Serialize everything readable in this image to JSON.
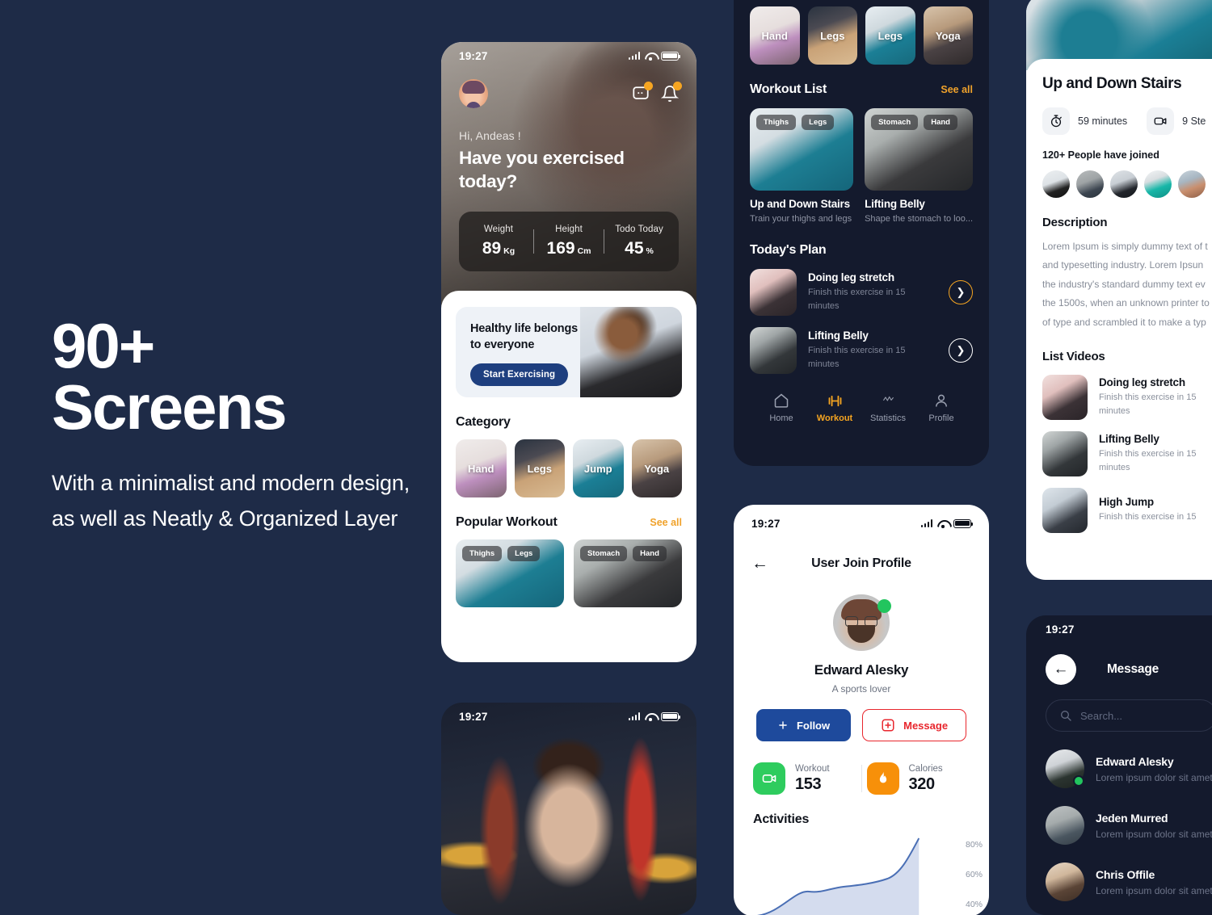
{
  "hero": {
    "title_line1": "90+",
    "title_line2": "Screens",
    "subtitle": "With a minimalist and modern design, as well as Neatly & Organized Layer"
  },
  "colors": {
    "background": "#1e2b47",
    "dark_screen": "#141a2d",
    "accent_orange": "#f6a521",
    "brand_blue": "#1e4a9c",
    "promo_blue": "#1e3f7f",
    "danger_red": "#e8262d",
    "green": "#2ecc5e"
  },
  "status_bar": {
    "time": "19:27"
  },
  "home_screen": {
    "greeting": "Hi, Andeas !",
    "question": "Have you exercised today?",
    "stats": [
      {
        "label": "Weight",
        "value": "89",
        "unit": "Kg"
      },
      {
        "label": "Height",
        "value": "169",
        "unit": "Cm"
      },
      {
        "label": "Todo Today",
        "value": "45",
        "unit": "%"
      }
    ],
    "promo": {
      "headline": "Healthy life belongs to everyone",
      "button": "Start Exercising"
    },
    "category_title": "Category",
    "categories": [
      {
        "label": "Hand"
      },
      {
        "label": "Legs"
      },
      {
        "label": "Jump"
      },
      {
        "label": "Yoga"
      }
    ],
    "popular_title": "Popular Workout",
    "see_all": "See all",
    "popular_items": [
      {
        "chips": [
          "Thighs",
          "Legs"
        ]
      },
      {
        "chips": [
          "Stomach",
          "Hand"
        ]
      }
    ]
  },
  "workout_screen": {
    "categories": [
      {
        "label": "Hand"
      },
      {
        "label": "Legs"
      },
      {
        "label": "Legs"
      },
      {
        "label": "Yoga"
      }
    ],
    "workout_list_title": "Workout List",
    "see_all": "See all",
    "workouts": [
      {
        "chips": [
          "Thighs",
          "Legs"
        ],
        "name": "Up and Down Stairs",
        "desc": "Train your thighs and legs"
      },
      {
        "chips": [
          "Stomach",
          "Hand"
        ],
        "name": "Lifting Belly",
        "desc": "Shape the stomach to loo..."
      }
    ],
    "plan_title": "Today's Plan",
    "plan_items": [
      {
        "name": "Doing leg stretch",
        "desc": "Finish this exercise in 15 minutes",
        "active": true
      },
      {
        "name": "Lifting Belly",
        "desc": "Finish this exercise in 15 minutes",
        "active": false
      }
    ],
    "tabs": [
      {
        "label": "Home",
        "icon": "home-icon",
        "active": false
      },
      {
        "label": "Workout",
        "icon": "dumbbell-icon",
        "active": true
      },
      {
        "label": "Statistics",
        "icon": "activity-icon",
        "active": false
      },
      {
        "label": "Profile",
        "icon": "person-icon",
        "active": false
      }
    ]
  },
  "profile_screen": {
    "nav_title": "User Join Profile",
    "name": "Edward Alesky",
    "bio": "A sports lover",
    "follow_button": "Follow",
    "message_button": "Message",
    "stats": [
      {
        "label": "Workout",
        "value": "153",
        "icon": "video-icon"
      },
      {
        "label": "Calories",
        "value": "320",
        "icon": "flame-icon"
      }
    ],
    "activities_title": "Activities",
    "chart_data": {
      "type": "area",
      "title": "Activities",
      "x": [
        0,
        1,
        2,
        3,
        4,
        5,
        6,
        7
      ],
      "values": [
        12,
        28,
        38,
        34,
        40,
        47,
        50,
        84
      ],
      "ytick_labels": [
        "80%",
        "60%",
        "40%"
      ],
      "ylim": [
        0,
        100
      ],
      "grid": false,
      "legend": "none",
      "line_color": "#4a6fb5",
      "fill_color": "#b9c6e3"
    }
  },
  "detail_screen": {
    "title": "Up and Down Stairs",
    "meta": [
      {
        "icon": "stopwatch-icon",
        "text": "59  minutes"
      },
      {
        "icon": "video-icon",
        "text": "9 Ste"
      }
    ],
    "joined": "120+ People have joined",
    "description_heading": "Description",
    "description_lines": [
      "Lorem Ipsum is simply dummy text of t",
      "and typesetting industry. Lorem Ipsun",
      "the industry's standard dummy text ev",
      "the 1500s, when an unknown printer to",
      "of type and scrambled it to make a typ"
    ],
    "videos_heading": "List Videos",
    "videos": [
      {
        "name": "Doing leg stretch",
        "desc": "Finish this exercise in 15 minutes"
      },
      {
        "name": "Lifting Belly",
        "desc": "Finish this exercise in 15 minutes"
      },
      {
        "name": "High Jump",
        "desc": "Finish this exercise in 15"
      }
    ]
  },
  "message_screen": {
    "nav_title": "Message",
    "search_placeholder": "Search...",
    "contacts": [
      {
        "name": "Edward Alesky",
        "preview": "Lorem ipsum dolor sit amet",
        "online": true
      },
      {
        "name": "Jeden Murred",
        "preview": "Lorem ipsum dolor sit amet",
        "online": false
      },
      {
        "name": "Chris Offile",
        "preview": "Lorem ipsum dolor sit amet",
        "online": false
      }
    ]
  }
}
